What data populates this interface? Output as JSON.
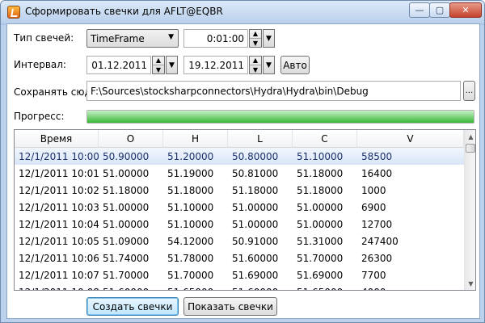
{
  "window": {
    "title": "Сформировать свечки для AFLT@EQBR",
    "minimize": "—",
    "maximize": "▢",
    "close": "✕"
  },
  "form": {
    "candle_type_label": "Тип свечей:",
    "candle_type_value": "TimeFrame",
    "timeframe_value": "0:01:00",
    "interval_label": "Интервал:",
    "interval_from": "01.12.2011",
    "interval_to": "19.12.2011",
    "auto_button": "Авто",
    "save_label": "Сохранять сюд",
    "save_path": "F:\\Sources\\stocksharpconnectors\\Hydra\\Hydra\\bin\\Debug",
    "browse_button": "...",
    "progress_label": "Прогресс:",
    "progress": 1.0
  },
  "grid": {
    "columns": [
      "Время",
      "O",
      "H",
      "L",
      "C",
      "V"
    ],
    "rows": [
      [
        "12/1/2011 10:00:",
        "50.90000",
        "51.20000",
        "50.80000",
        "51.10000",
        "58500"
      ],
      [
        "12/1/2011 10:01:",
        "51.00000",
        "51.19000",
        "50.81000",
        "51.18000",
        "16400"
      ],
      [
        "12/1/2011 10:02:",
        "51.18000",
        "51.18000",
        "51.18000",
        "51.18000",
        "1000"
      ],
      [
        "12/1/2011 10:03:",
        "51.00000",
        "51.10000",
        "51.00000",
        "51.00000",
        "6900"
      ],
      [
        "12/1/2011 10:04:",
        "51.00000",
        "51.10000",
        "51.00000",
        "51.00000",
        "12700"
      ],
      [
        "12/1/2011 10:05:",
        "51.09000",
        "54.12000",
        "50.91000",
        "51.31000",
        "247400"
      ],
      [
        "12/1/2011 10:06:",
        "51.74000",
        "51.78000",
        "51.60000",
        "51.70000",
        "26300"
      ],
      [
        "12/1/2011 10:07:",
        "51.70000",
        "51.70000",
        "51.69000",
        "51.69000",
        "7700"
      ],
      [
        "12/1/2011 10:08:",
        "51.60000",
        "51.65000",
        "51.60000",
        "51.65000",
        "4000"
      ]
    ],
    "selected_row": 0
  },
  "actions": {
    "create_button": "Создать свечки",
    "show_button": "Показать свечки"
  },
  "colors": {
    "accent": "#37b837",
    "selection": "#d9e6f7"
  }
}
